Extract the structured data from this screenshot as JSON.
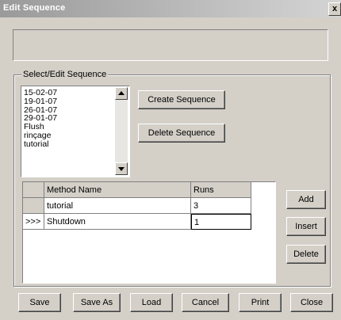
{
  "window": {
    "title": "Edit Sequence",
    "close_glyph": "x"
  },
  "group": {
    "label": "Select/Edit Sequence"
  },
  "sequences": [
    "15-02-07",
    "19-01-07",
    "26-01-07",
    "29-01-07",
    "Flush",
    "rinçage",
    "tutorial"
  ],
  "buttons": {
    "create_sequence": "Create Sequence",
    "delete_sequence": "Delete Sequence",
    "add": "Add",
    "insert": "Insert",
    "delete": "Delete",
    "save": "Save",
    "save_as": "Save As",
    "load": "Load",
    "cancel": "Cancel",
    "print": "Print",
    "close": "Close"
  },
  "table": {
    "columns": [
      "Method Name",
      "Runs"
    ],
    "rows": [
      {
        "marker": "",
        "method": "tutorial",
        "runs": "3"
      },
      {
        "marker": ">>>",
        "method": "Shutdown",
        "runs": "1"
      }
    ]
  }
}
